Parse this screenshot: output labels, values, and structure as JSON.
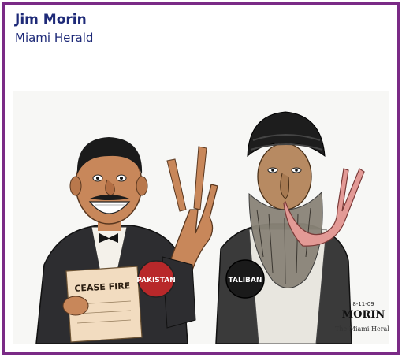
{
  "header": {
    "author": "Jim Morin",
    "publication": "Miami Herald"
  },
  "cartoon": {
    "paper_label": "CEASE FIRE",
    "left_badge": "PAKISTAN",
    "right_badge": "TALIBAN",
    "signature": "MORIN",
    "date": "8-11-09",
    "credit": "The Miami Herald"
  },
  "colors": {
    "frame": "#7a2a86",
    "header_text": "#1e2a78",
    "badge": "#b8282a",
    "badge_dark": "#1a1a1a",
    "skin": "#c8875a",
    "paper": "#f2dcc0"
  }
}
